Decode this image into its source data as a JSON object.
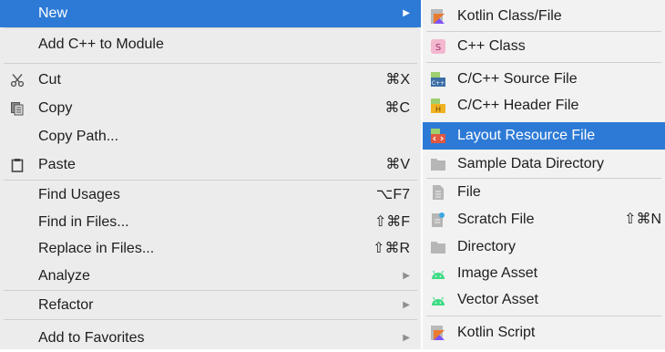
{
  "main_menu": {
    "items": [
      {
        "label": "New",
        "has_arrow": true,
        "highlighted": true
      },
      {
        "label": "Add C++ to Module"
      },
      {
        "label": "Cut",
        "icon": "scissors-icon",
        "shortcut": "⌘X"
      },
      {
        "label": "Copy",
        "icon": "copy-icon",
        "shortcut": "⌘C"
      },
      {
        "label": "Copy Path..."
      },
      {
        "label": "Paste",
        "icon": "clipboard-icon",
        "shortcut": "⌘V"
      },
      {
        "label": "Find Usages",
        "shortcut": "⌥F7"
      },
      {
        "label": "Find in Files...",
        "shortcut": "⇧⌘F"
      },
      {
        "label": "Replace in Files...",
        "shortcut": "⇧⌘R"
      },
      {
        "label": "Analyze",
        "has_arrow": true
      },
      {
        "label": "Refactor",
        "has_arrow": true
      },
      {
        "label": "Add to Favorites",
        "has_arrow": true
      }
    ]
  },
  "sub_menu": {
    "items": [
      {
        "label": "Kotlin Class/File",
        "icon": "kotlin-file-icon"
      },
      {
        "label": "C++ Class",
        "icon": "cpp-class-icon",
        "icon_text": "S"
      },
      {
        "label": "C/C++ Source File",
        "icon": "cpp-source-file-icon",
        "icon_text": "C++"
      },
      {
        "label": "C/C++ Header File",
        "icon": "cpp-header-file-icon",
        "icon_text": "H"
      },
      {
        "label": "Layout Resource File",
        "icon": "layout-resource-file-icon",
        "highlighted": true
      },
      {
        "label": "Sample Data Directory",
        "icon": "folder-icon"
      },
      {
        "label": "File",
        "icon": "file-icon"
      },
      {
        "label": "Scratch File",
        "icon": "scratch-file-icon",
        "shortcut": "⇧⌘N"
      },
      {
        "label": "Directory",
        "icon": "folder-icon"
      },
      {
        "label": "Image Asset",
        "icon": "android-icon"
      },
      {
        "label": "Vector Asset",
        "icon": "android-icon"
      },
      {
        "label": "Kotlin Script",
        "icon": "kotlin-script-icon"
      }
    ]
  },
  "colors": {
    "highlight": "#2d7ad6",
    "menu_bg": "#ececec",
    "android_green": "#3ddc84",
    "kotlin_orange": "#e97b2f",
    "kotlin_purple": "#7f52ff"
  }
}
